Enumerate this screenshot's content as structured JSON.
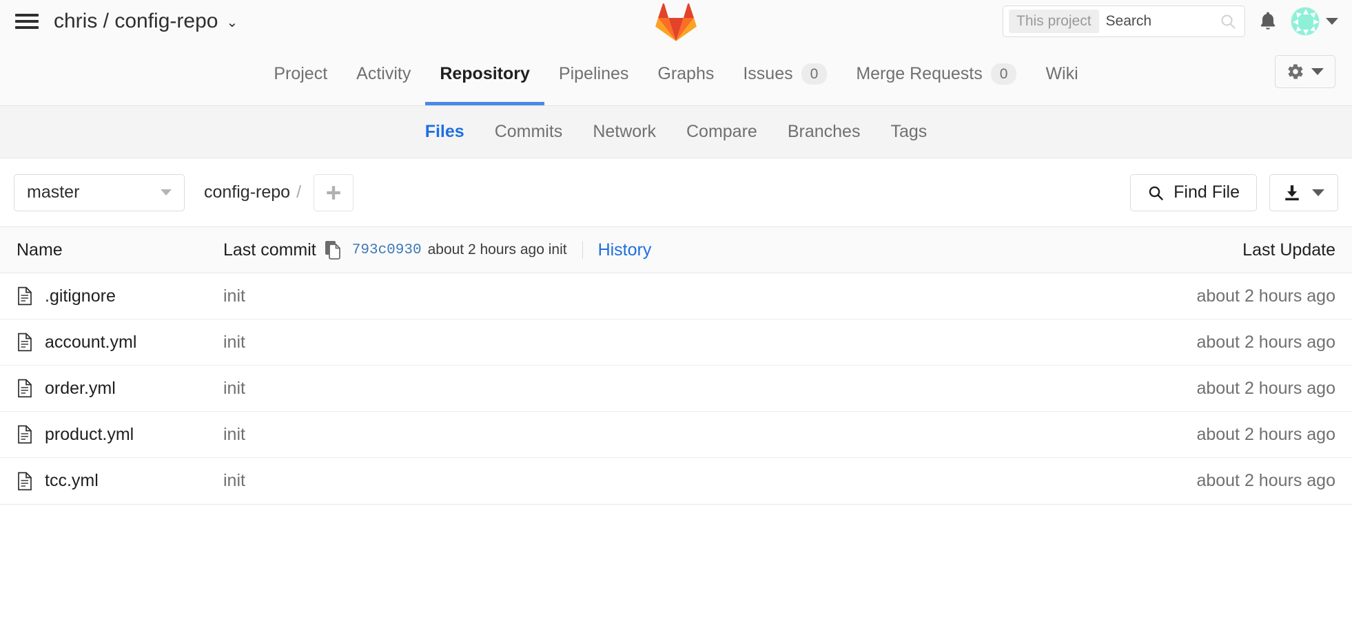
{
  "header": {
    "menu_icon": "hamburger-icon",
    "namespace": "chris",
    "separator": "/",
    "project": "config-repo",
    "title": "chris / config-repo",
    "caret": "⌄",
    "logo": "gitlab-tanuki-logo",
    "search": {
      "scope_label": "This project",
      "placeholder": "Search",
      "value": "",
      "icon": "search-icon"
    },
    "notifications_icon": "bell-icon",
    "avatar": "user-avatar",
    "avatar_caret": "chevron-down-icon"
  },
  "main_nav": {
    "items": [
      {
        "label": "Project",
        "badge": null,
        "active": false
      },
      {
        "label": "Activity",
        "badge": null,
        "active": false
      },
      {
        "label": "Repository",
        "badge": null,
        "active": true
      },
      {
        "label": "Pipelines",
        "badge": null,
        "active": false
      },
      {
        "label": "Graphs",
        "badge": null,
        "active": false
      },
      {
        "label": "Issues",
        "badge": "0",
        "active": false
      },
      {
        "label": "Merge Requests",
        "badge": "0",
        "active": false
      },
      {
        "label": "Wiki",
        "badge": null,
        "active": false
      }
    ],
    "settings_icon": "gear-icon",
    "settings_caret": "chevron-down-icon"
  },
  "sub_nav": {
    "items": [
      {
        "label": "Files",
        "active": true
      },
      {
        "label": "Commits",
        "active": false
      },
      {
        "label": "Network",
        "active": false
      },
      {
        "label": "Compare",
        "active": false
      },
      {
        "label": "Branches",
        "active": false
      },
      {
        "label": "Tags",
        "active": false
      }
    ]
  },
  "toolbar": {
    "branch": "master",
    "branch_caret": "chevron-down-icon",
    "breadcrumb_root": "config-repo",
    "breadcrumb_separator": "/",
    "add_button_icon": "plus-icon",
    "find_file_label": "Find File",
    "find_file_icon": "search-icon",
    "download_icon": "download-icon",
    "download_caret": "chevron-down-icon"
  },
  "table": {
    "headers": {
      "name": "Name",
      "last_commit": "Last commit",
      "last_update": "Last Update"
    },
    "head_commit": {
      "copy_icon": "copy-icon",
      "sha": "793c0930",
      "meta": "about 2 hours ago init",
      "history_label": "History"
    },
    "rows": [
      {
        "icon": "file-icon",
        "name": ".gitignore",
        "commit": "init",
        "updated": "about 2 hours ago"
      },
      {
        "icon": "file-icon",
        "name": "account.yml",
        "commit": "init",
        "updated": "about 2 hours ago"
      },
      {
        "icon": "file-icon",
        "name": "order.yml",
        "commit": "init",
        "updated": "about 2 hours ago"
      },
      {
        "icon": "file-icon",
        "name": "product.yml",
        "commit": "init",
        "updated": "about 2 hours ago"
      },
      {
        "icon": "file-icon",
        "name": "tcc.yml",
        "commit": "init",
        "updated": "about 2 hours ago"
      }
    ]
  },
  "colors": {
    "accent_blue": "#1f6fe0",
    "active_underline": "#4a89e8",
    "logo_red": "#e24329",
    "logo_orange": "#fc6d26",
    "logo_light_orange": "#fca326",
    "avatar_bg": "#8ff0d8",
    "muted_text": "#707070"
  }
}
